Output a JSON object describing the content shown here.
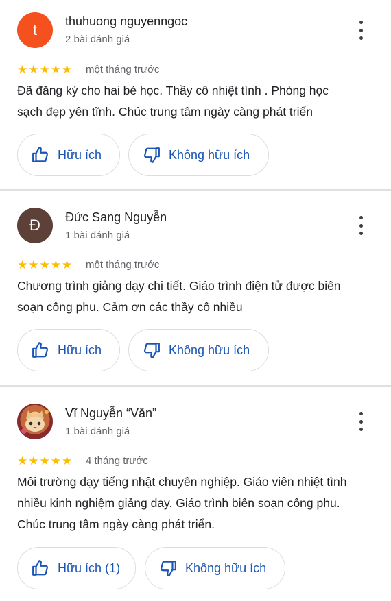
{
  "reviews": [
    {
      "avatar": {
        "letter": "t",
        "color": "#f4511e"
      },
      "name": "thuhuong nguyenngoc",
      "review_count": "2 bài đánh giá",
      "rating": 5,
      "stars": "★★★★★",
      "time": "một tháng trước",
      "lines": [
        "Đã đăng ký cho hai bé học.  Thầy cô nhiệt tình . Phòng học",
        "sạch đẹp yên tĩnh. Chúc trung tâm ngày càng phát triển"
      ],
      "helpful_label": "Hữu ích",
      "not_helpful_label": "Không hữu ích"
    },
    {
      "avatar": {
        "letter": "Đ",
        "color": "#5d4037"
      },
      "name": "Đức Sang Nguyễn",
      "review_count": "1 bài đánh giá",
      "rating": 5,
      "stars": "★★★★★",
      "time": "một tháng trước",
      "lines": [
        "Chương trình giảng dạy chi tiết. Giáo trình điện tử được biên",
        "soạn công phu. Cảm ơn các thầy cô nhiều"
      ],
      "helpful_label": "Hữu ích",
      "not_helpful_label": "Không hữu ích"
    },
    {
      "avatar": {
        "letter": "",
        "color": "#b0413e",
        "image": "cat-photo"
      },
      "name": "Vĩ Nguyễn “Văn”",
      "review_count": "1 bài đánh giá",
      "rating": 5,
      "stars": "★★★★★",
      "time": "4 tháng trước",
      "lines": [
        "Môi trường dạy tiếng nhật chuyên nghiệp. Giáo viên nhiệt tình",
        "nhiều kinh nghiệm giảng day. Giáo trình biên soạn công phu.",
        "Chúc trung tâm ngày càng phát triển."
      ],
      "helpful_label": "Hữu ích (1)",
      "not_helpful_label": "Không hữu ích"
    }
  ],
  "icons": {
    "thumbs_up": "thumbs-up-icon",
    "thumbs_down": "thumbs-down-icon",
    "more": "more-vert-icon"
  },
  "colors": {
    "accent": "#1a55b5",
    "star": "#fbbc04",
    "divider": "#e0e0e0"
  }
}
